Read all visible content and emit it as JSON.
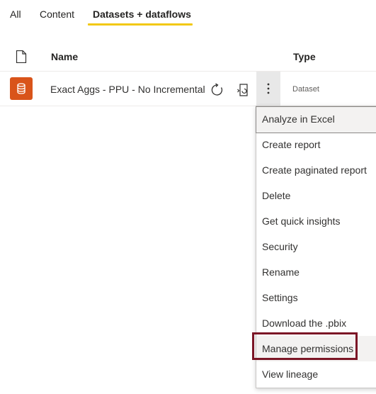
{
  "tabs": [
    {
      "label": "All"
    },
    {
      "label": "Content"
    },
    {
      "label": "Datasets + dataflows",
      "active": true
    }
  ],
  "colors": {
    "tab_underline": "#f2c811",
    "dataset_icon": "#d9541a",
    "highlight": "#7b1626"
  },
  "table": {
    "headers": {
      "name": "Name",
      "type": "Type"
    },
    "rows": [
      {
        "icon": "database-icon",
        "name": "Exact Aggs - PPU - No Incremental",
        "type": "Dataset"
      }
    ]
  },
  "context_menu": {
    "items": [
      "Analyze in Excel",
      "Create report",
      "Create paginated report",
      "Delete",
      "Get quick insights",
      "Security",
      "Rename",
      "Settings",
      "Download the .pbix",
      "Manage permissions",
      "View lineage"
    ],
    "highlighted_item": "Manage permissions"
  }
}
